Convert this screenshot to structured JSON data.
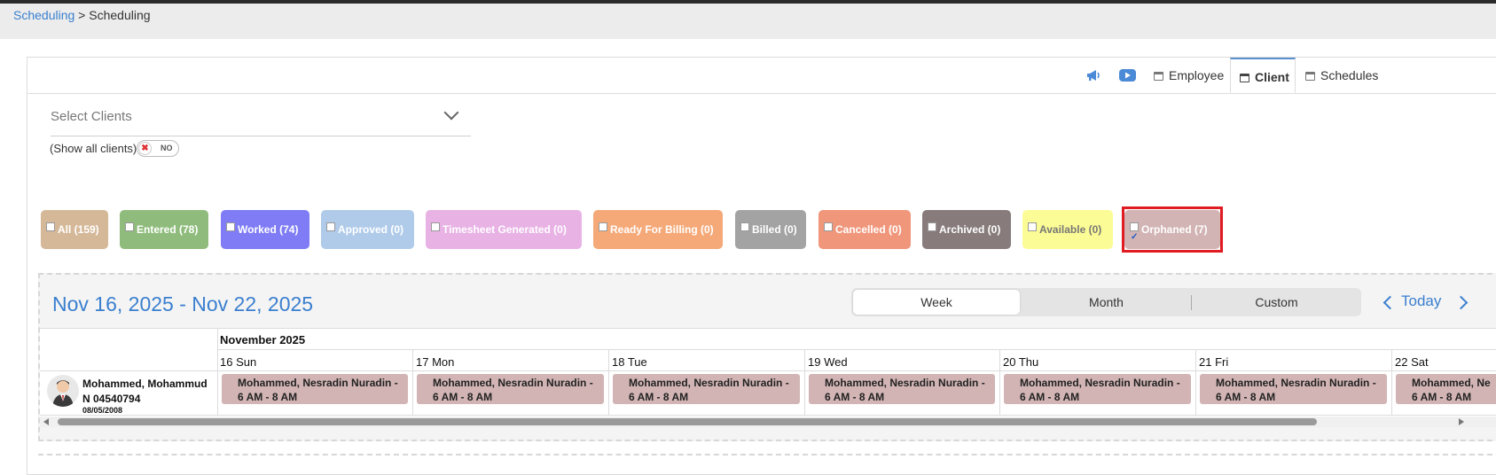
{
  "breadcrumb": {
    "link": "Scheduling",
    "separator": ">",
    "current": "Scheduling"
  },
  "tabs": {
    "employee": "Employee",
    "client": "Client",
    "schedules": "Schedules"
  },
  "icons": {
    "announcement": "megaphone-icon",
    "video": "youtube-icon",
    "calendar": "calendar-icon"
  },
  "filter": {
    "select_clients_placeholder": "Select Clients",
    "show_all_label": "(Show all clients)",
    "toggle_state": "NO"
  },
  "status_chips": [
    {
      "label": "All (159)",
      "color": "#d5b898",
      "checked": false
    },
    {
      "label": "Entered (78)",
      "color": "#8fbc7c",
      "checked": false
    },
    {
      "label": "Worked (74)",
      "color": "#7f7cf5",
      "checked": false
    },
    {
      "label": "Approved (0)",
      "color": "#afcbe9",
      "checked": false
    },
    {
      "label": "Timesheet Generated (0)",
      "color": "#e8b2e5",
      "checked": false
    },
    {
      "label": "Ready For Billing (0)",
      "color": "#f5a978",
      "checked": false
    },
    {
      "label": "Billed (0)",
      "color": "#a3a3a3",
      "checked": false
    },
    {
      "label": "Cancelled (0)",
      "color": "#f0967b",
      "checked": false
    },
    {
      "label": "Archived (0)",
      "color": "#877b7b",
      "checked": false
    },
    {
      "label": "Available (0)",
      "color": "#fcfc96",
      "checked": false
    },
    {
      "label": "Orphaned (7)",
      "color": "#d2b4b4",
      "checked": true
    }
  ],
  "calendar": {
    "date_range": "Nov 16, 2025 - Nov 22, 2025",
    "views": {
      "week": "Week",
      "month": "Month",
      "custom": "Custom"
    },
    "active_view": "Week",
    "today_label": "Today",
    "month_heading": "November 2025",
    "days": [
      "16 Sun",
      "17 Mon",
      "18 Tue",
      "19 Wed",
      "20 Thu",
      "21 Fri",
      "22 Sat"
    ],
    "client": {
      "name": "Mohammed, Mohammud N 04540794",
      "dob": "08/05/2008"
    },
    "shifts": [
      {
        "line1": "Mohammed, Nesradin Nuradin -",
        "line2": "6 AM - 8 AM"
      },
      {
        "line1": "Mohammed, Nesradin Nuradin -",
        "line2": "6 AM - 8 AM"
      },
      {
        "line1": "Mohammed, Nesradin Nuradin -",
        "line2": "6 AM - 8 AM"
      },
      {
        "line1": "Mohammed, Nesradin Nuradin -",
        "line2": "6 AM - 8 AM"
      },
      {
        "line1": "Mohammed, Nesradin Nuradin -",
        "line2": "6 AM - 8 AM"
      },
      {
        "line1": "Mohammed, Nesradin Nuradin -",
        "line2": "6 AM - 8 AM"
      },
      {
        "line1": "Mohammed, Ne",
        "line2": "6 AM - 8 AM"
      }
    ]
  }
}
